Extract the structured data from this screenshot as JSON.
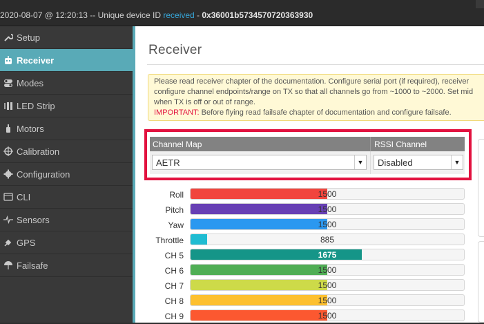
{
  "status_bar": {
    "timestamp": "2020-08-07 @ 12:20:13",
    "separator": " -- Unique device ID ",
    "received": "received",
    "dash": " - ",
    "device_id": "0x36001b5734570720363930"
  },
  "sidebar": {
    "items": [
      {
        "label": "Setup",
        "icon": "wrench-icon"
      },
      {
        "label": "Receiver",
        "icon": "receiver-icon",
        "active": true
      },
      {
        "label": "Modes",
        "icon": "toggle-icon"
      },
      {
        "label": "LED Strip",
        "icon": "led-strip-icon"
      },
      {
        "label": "Motors",
        "icon": "motor-icon"
      },
      {
        "label": "Calibration",
        "icon": "crosshair-icon"
      },
      {
        "label": "Configuration",
        "icon": "gear-icon"
      },
      {
        "label": "CLI",
        "icon": "terminal-icon"
      },
      {
        "label": "Sensors",
        "icon": "pulse-icon"
      },
      {
        "label": "GPS",
        "icon": "satellite-icon"
      },
      {
        "label": "Failsafe",
        "icon": "parachute-icon"
      }
    ]
  },
  "main": {
    "title": "Receiver",
    "notice": {
      "line1": "Please read receiver chapter of the documentation. Configure serial port (if required), receiver",
      "line2": "configure channel endpoints/range on TX so that all channels go from ~1000 to ~2000. Set mid",
      "line3": "when TX is off or out of range.",
      "important_label": "IMPORTANT:",
      "important_text": " Before flying read failsafe chapter of documentation and configure failsafe."
    },
    "channel_map": {
      "header": "Channel Map",
      "value": "AETR"
    },
    "rssi_channel": {
      "header": "RSSI Channel",
      "value": "Disabled"
    },
    "channels": [
      {
        "label": "Roll",
        "value": "1500",
        "fraction": 0.5,
        "color": "#f1453d"
      },
      {
        "label": "Pitch",
        "value": "1500",
        "fraction": 0.5,
        "color": "#673fb4"
      },
      {
        "label": "Yaw",
        "value": "1500",
        "fraction": 0.5,
        "color": "#2b98f0"
      },
      {
        "label": "Throttle",
        "value": "885",
        "fraction": 0.06,
        "color": "#1fbcd2"
      },
      {
        "label": "CH 5",
        "value": "1675",
        "fraction": 0.625,
        "color": "#159588"
      },
      {
        "label": "CH 6",
        "value": "1500",
        "fraction": 0.5,
        "color": "#50ae55"
      },
      {
        "label": "CH 7",
        "value": "1500",
        "fraction": 0.5,
        "color": "#cdda49"
      },
      {
        "label": "CH 8",
        "value": "1500",
        "fraction": 0.5,
        "color": "#fdc02f"
      },
      {
        "label": "CH 9",
        "value": "1500",
        "fraction": 0.5,
        "color": "#fc5830"
      }
    ]
  },
  "colors": {
    "accent": "#59aab7",
    "highlight_red": "#e2123f"
  }
}
